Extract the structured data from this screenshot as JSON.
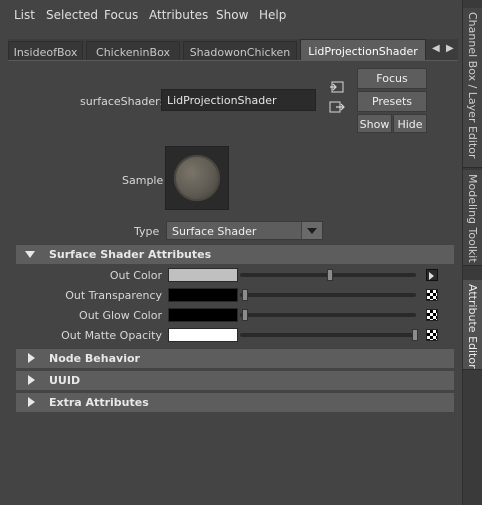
{
  "menu": {
    "items": [
      "List",
      "Selected",
      "Focus",
      "Attributes",
      "Show",
      "Help"
    ]
  },
  "tabs": [
    {
      "label": "InsideofBox",
      "active": false
    },
    {
      "label": "ChickeninBox",
      "active": false
    },
    {
      "label": "ShadowonChicken",
      "active": false
    },
    {
      "label": "LidProjectionShader",
      "active": true
    }
  ],
  "right_tabs": [
    "Channel Box / Layer Editor",
    "Modeling Toolkit",
    "Attribute Editor"
  ],
  "node": {
    "type_label": "surfaceShader:",
    "name": "LidProjectionShader"
  },
  "buttons": {
    "focus": "Focus",
    "presets": "Presets",
    "show": "Show",
    "hide": "Hide"
  },
  "sample": {
    "label": "Sample"
  },
  "type": {
    "label": "Type",
    "value": "Surface Shader"
  },
  "sections": {
    "surface_shader_attributes": "Surface Shader Attributes",
    "node_behavior": "Node Behavior",
    "uuid": "UUID",
    "extra_attributes": "Extra Attributes"
  },
  "attributes": [
    {
      "label": "Out Color",
      "color": "#c0c0c0",
      "slider": 0.5,
      "map": "mapped"
    },
    {
      "label": "Out Transparency",
      "color": "#000000",
      "slider": 0.0,
      "map": "checker"
    },
    {
      "label": "Out Glow Color",
      "color": "#000000",
      "slider": 0.0,
      "map": "checker"
    },
    {
      "label": "Out Matte Opacity",
      "color": "#ffffff",
      "slider": 1.0,
      "map": "checker"
    }
  ],
  "icons": [
    "select-input-icon",
    "select-output-icon",
    "tab-scroll-left-icon",
    "tab-scroll-right-icon"
  ]
}
